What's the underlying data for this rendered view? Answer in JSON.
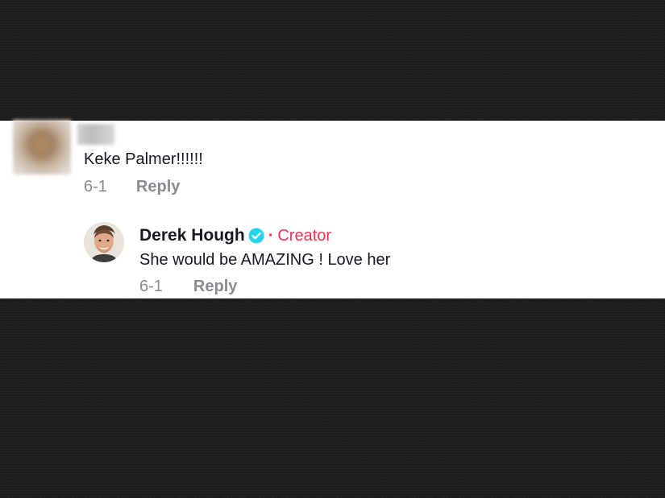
{
  "comment": {
    "text": "Keke Palmer!!!!!!",
    "date": "6-1",
    "reply_label": "Reply"
  },
  "reply": {
    "author": "Derek Hough",
    "verified_icon": "verified-badge-icon",
    "separator": "·",
    "role": "Creator",
    "text": "She would be AMAZING ! Love her",
    "date": "6-1",
    "reply_label": "Reply"
  },
  "colors": {
    "background": "#1f1f1f",
    "panel": "#ffffff",
    "text": "#161823",
    "muted": "#8a8b91",
    "creator": "#fe2c55",
    "verified": "#20d5ec"
  }
}
